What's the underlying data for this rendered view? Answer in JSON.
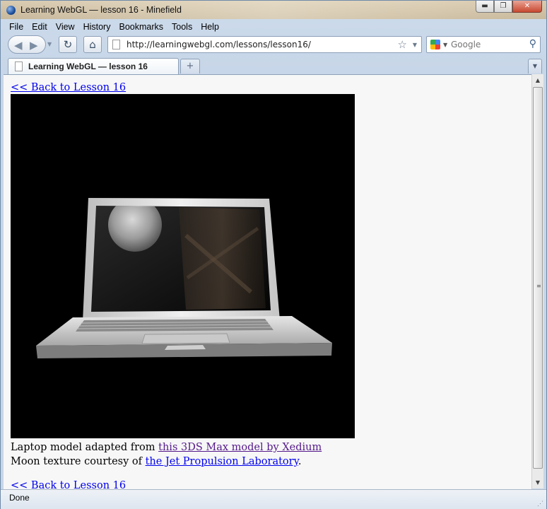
{
  "window": {
    "title": "Learning WebGL — lesson 16 - Minefield",
    "controls": {
      "minimize": "▬",
      "maximize": "❐",
      "close": "✕"
    }
  },
  "menu": {
    "items": [
      "File",
      "Edit",
      "View",
      "History",
      "Bookmarks",
      "Tools",
      "Help"
    ]
  },
  "toolbar": {
    "back_icon": "◀",
    "forward_icon": "▶",
    "dropdown_icon": "▼",
    "reload_icon": "↻",
    "home_icon": "⌂",
    "url": "http://learningwebgl.com/lessons/lesson16/",
    "bookmark_star_icon": "☆",
    "url_dropdown_icon": "▼",
    "search_engine_dropdown_icon": "▼",
    "search_placeholder": "Google",
    "search_go_icon": "⚲"
  },
  "tabs": {
    "items": [
      {
        "label": "Learning WebGL — lesson 16"
      }
    ],
    "new_tab_icon": "+",
    "list_all_tabs_icon": "▼"
  },
  "page": {
    "back_link_top": "<< Back to Lesson 16",
    "laptop_credit_prefix": "Laptop model adapted from ",
    "laptop_credit_link": "this 3DS Max model by Xedium",
    "moon_credit_prefix": "Moon texture courtesy of ",
    "moon_credit_link": "the Jet Propulsion Laboratory",
    "moon_credit_suffix": ".",
    "back_link_bottom": "<< Back to Lesson 16"
  },
  "scrollbar": {
    "up_icon": "▲",
    "down_icon": "▼",
    "grip_icon": "≡"
  },
  "status": {
    "text": "Done",
    "resize_grip_icon": "⋰"
  },
  "colors": {
    "link": "#0000ee",
    "visited_link": "#551a8b",
    "canvas_background": "#000000"
  }
}
